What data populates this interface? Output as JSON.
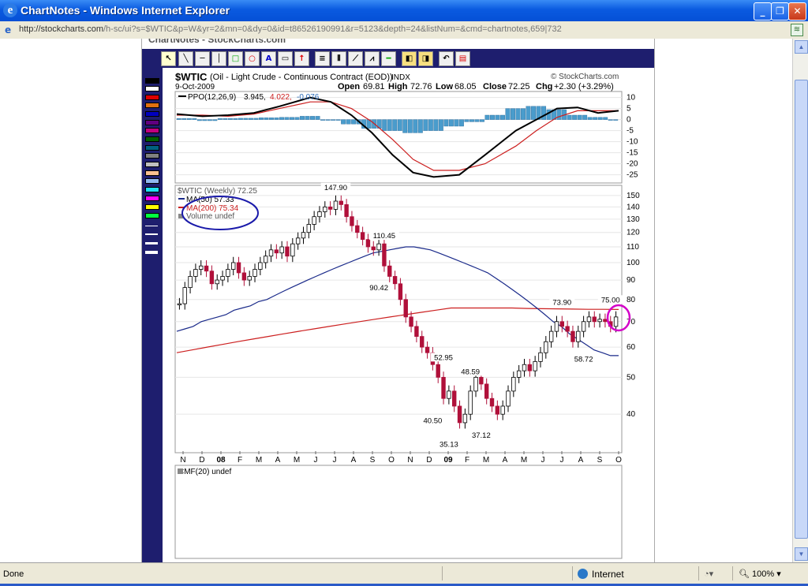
{
  "window": {
    "title": "ChartNotes - Windows Internet Explorer",
    "minimize": "_",
    "maximize": "❐",
    "close": "✕"
  },
  "address": {
    "url_host": "http://stockcharts.com",
    "url_path": "/h-sc/ui?s=$WTIC&p=W&yr=2&mn=0&dy=0&id=t86526190991&r=5123&depth=24&listNum=&cmd=chartnotes,659|732"
  },
  "status": {
    "text": "Done",
    "zone": "Internet",
    "zoom": "100%"
  },
  "page": {
    "header_cut": "ChartNotes - StockCharts.com"
  },
  "chart_header": {
    "symbol": "$WTIC",
    "name": "(Oil - Light Crude - Continuous Contract (EOD))",
    "exchange": "INDX",
    "brand": "© StockCharts.com",
    "date": "9-Oct-2009",
    "open_label": "Open",
    "open": "69.81",
    "high_label": "High",
    "high": "72.76",
    "low_label": "Low",
    "low": "68.05",
    "close_label": "Close",
    "close": "72.25",
    "chg_label": "Chg",
    "chg": "+2.30 (+3.29%)"
  },
  "ppo_legend": {
    "label": "PPO(12,26,9)",
    "v1": "3.945,",
    "v2": "4.022,",
    "v3": "-0.076"
  },
  "price_legend": {
    "title": "$WTIC (Weekly) 72.25",
    "ma50": "MA(50) 57.33",
    "ma200": "MA(200) 75.34",
    "volume": "Volume undef"
  },
  "cmf_legend": "CMF(20) undef",
  "colors": {
    "up": "#000000",
    "down": "#b0103a",
    "ma50": "#1a2a8a",
    "ma200": "#cc1f1f",
    "histogram": "#4a9ccc",
    "annotation_circle_blue": "#1a1aaa",
    "annotation_circle_magenta": "#d400c8"
  },
  "chart_data": [
    {
      "type": "bar",
      "title": "PPO(12,26,9)",
      "ylim": [
        -28,
        12
      ],
      "y_ticks": [
        "10",
        "5",
        "0",
        "-5",
        "-10",
        "-15",
        "-20",
        "-25"
      ],
      "ppo_line": [
        [
          0,
          2.5
        ],
        [
          5,
          1.5
        ],
        [
          10,
          2
        ],
        [
          15,
          3
        ],
        [
          20,
          6
        ],
        [
          26,
          10
        ],
        [
          30,
          8
        ],
        [
          34,
          2
        ],
        [
          38,
          -6
        ],
        [
          42,
          -16
        ],
        [
          46,
          -24
        ],
        [
          50,
          -26
        ],
        [
          55,
          -25
        ],
        [
          60,
          -16
        ],
        [
          66,
          -5
        ],
        [
          70,
          0
        ],
        [
          74,
          5
        ],
        [
          78,
          5.5
        ],
        [
          82,
          3
        ],
        [
          86,
          4
        ]
      ],
      "signal_line": [
        [
          0,
          2
        ],
        [
          5,
          2
        ],
        [
          10,
          1.5
        ],
        [
          15,
          2.5
        ],
        [
          20,
          5
        ],
        [
          26,
          8
        ],
        [
          30,
          8
        ],
        [
          34,
          5
        ],
        [
          38,
          -1
        ],
        [
          42,
          -9
        ],
        [
          46,
          -18
        ],
        [
          50,
          -23
        ],
        [
          55,
          -23
        ],
        [
          60,
          -20
        ],
        [
          66,
          -12
        ],
        [
          70,
          -5
        ],
        [
          74,
          1
        ],
        [
          78,
          4
        ],
        [
          82,
          4
        ],
        [
          86,
          4
        ]
      ],
      "histogram": [
        [
          0,
          0.5
        ],
        [
          4,
          -0.5
        ],
        [
          8,
          0.5
        ],
        [
          12,
          0.6
        ],
        [
          16,
          0.8
        ],
        [
          20,
          1
        ],
        [
          24,
          1.5
        ],
        [
          28,
          0
        ],
        [
          32,
          -2
        ],
        [
          36,
          -4
        ],
        [
          40,
          -5
        ],
        [
          44,
          -6
        ],
        [
          48,
          -5
        ],
        [
          52,
          -3
        ],
        [
          56,
          -1
        ],
        [
          60,
          2
        ],
        [
          64,
          5
        ],
        [
          68,
          6
        ],
        [
          72,
          4.5
        ],
        [
          76,
          2
        ],
        [
          80,
          1
        ],
        [
          84,
          0
        ]
      ]
    },
    {
      "type": "candlestick",
      "title": "$WTIC (Weekly)",
      "y_scale": "log",
      "ylim": [
        32,
        158
      ],
      "y_ticks": [
        "150",
        "140",
        "130",
        "120",
        "110",
        "100",
        "90",
        "80",
        "70",
        "60",
        "50",
        "40"
      ],
      "x_ticks": [
        "N",
        "D",
        "08",
        "F",
        "M",
        "A",
        "M",
        "J",
        "J",
        "A",
        "S",
        "O",
        "N",
        "D",
        "09",
        "F",
        "M",
        "A",
        "M",
        "J",
        "J",
        "A",
        "S",
        "O"
      ],
      "annotations": [
        {
          "text": "147.90",
          "x": 29,
          "y": 147.9
        },
        {
          "text": "110.45",
          "x": 38,
          "y": 110.45
        },
        {
          "text": "90.42",
          "x": 37,
          "y": 90.42
        },
        {
          "text": "52.95",
          "x": 49,
          "y": 52.95
        },
        {
          "text": "48.59",
          "x": 54,
          "y": 48.59
        },
        {
          "text": "40.50",
          "x": 47,
          "y": 40.5
        },
        {
          "text": "35.13",
          "x": 50,
          "y": 35.13
        },
        {
          "text": "37.12",
          "x": 56,
          "y": 37.12
        },
        {
          "text": "73.90",
          "x": 71,
          "y": 73.9
        },
        {
          "text": "58.72",
          "x": 75,
          "y": 58.72
        },
        {
          "text": "75.00",
          "x": 80,
          "y": 75
        }
      ],
      "closes": [
        78,
        86,
        92,
        96,
        98,
        95,
        88,
        90,
        92,
        96,
        100,
        94,
        90,
        92,
        96,
        100,
        104,
        108,
        106,
        110,
        104,
        112,
        116,
        120,
        126,
        132,
        136,
        140,
        138,
        145,
        142,
        132,
        125,
        120,
        115,
        110,
        108,
        112,
        98,
        92,
        88,
        80,
        72,
        68,
        64,
        60,
        58,
        54,
        50,
        44,
        46,
        42,
        38,
        40,
        46,
        50,
        48,
        44,
        42,
        40,
        42,
        46,
        50,
        52,
        54,
        52,
        55,
        58,
        62,
        66,
        70,
        68,
        66,
        62,
        66,
        70,
        72,
        70,
        71,
        70,
        68,
        72
      ],
      "ma50": [
        66,
        67,
        68,
        70,
        71,
        72,
        73,
        75,
        76,
        77,
        79,
        80,
        82,
        84,
        86,
        88,
        90,
        92,
        94,
        96,
        98,
        100,
        102,
        104,
        106,
        107,
        108,
        109,
        110,
        110,
        109,
        108,
        106,
        104,
        102,
        100,
        98,
        96,
        94,
        91,
        88,
        85,
        82,
        79,
        76,
        73,
        70,
        68,
        65,
        63,
        61,
        59,
        58,
        57,
        57
      ],
      "ma200": [
        58,
        59,
        60,
        61,
        62,
        63,
        64,
        65,
        66,
        67,
        68,
        69,
        70,
        71,
        72,
        73,
        74,
        75,
        76,
        76,
        76,
        76,
        76,
        75.8,
        75.7,
        75.6,
        75.5,
        75.4,
        75.4,
        75.34
      ]
    }
  ]
}
